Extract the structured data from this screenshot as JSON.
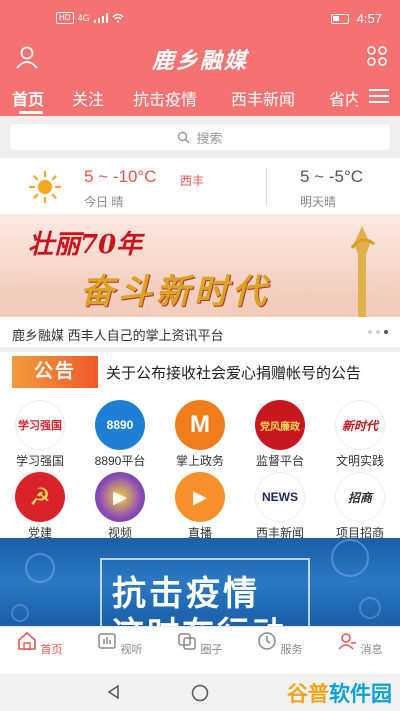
{
  "status_bar": {
    "network": "HD",
    "signal": "4G",
    "time": "4:57"
  },
  "header": {
    "title": "鹿乡融媒",
    "user_icon": "user-icon",
    "grid_icon": "apps-grid-icon"
  },
  "tabs": [
    {
      "label": "首页",
      "active": true
    },
    {
      "label": "关注"
    },
    {
      "label": "抗击疫情"
    },
    {
      "label": "西丰新闻"
    },
    {
      "label": "省内"
    }
  ],
  "search": {
    "placeholder": "搜索"
  },
  "weather": {
    "today_temp": "5 ~ -10°C",
    "location": "西丰",
    "today_label": "今日 晴",
    "tomorrow_temp": "5 ~ -5°C",
    "tomorrow_label": "明天晴"
  },
  "banner": {
    "line1": "壮丽70年",
    "line2": "奋斗新时代"
  },
  "caption": {
    "text": "鹿乡融媒   西丰人自己的掌上资讯平台",
    "dots": 3,
    "active_dot": 2
  },
  "notice": {
    "badge": "公告",
    "text": "关于公布接收社会爱心捐赠帐号的公告"
  },
  "grid": [
    {
      "label": "学习强国",
      "icon_text": "学习强国",
      "color": "#d9232b"
    },
    {
      "label": "8890平台",
      "icon_text": "8890",
      "color": "#1e7fd6"
    },
    {
      "label": "掌上政务",
      "icon_text": "M",
      "color": "#f07d1b"
    },
    {
      "label": "监督平台",
      "icon_text": "党风廉政",
      "color": "#c8171e"
    },
    {
      "label": "文明实践",
      "icon_text": "新时代",
      "color": "#ffffff"
    },
    {
      "label": "党建",
      "icon_text": "☭",
      "color": "#d9232b"
    },
    {
      "label": "视频",
      "icon_text": "▶",
      "color": "#6a4aa8"
    },
    {
      "label": "直播",
      "icon_text": "▶",
      "color": "#f5902a"
    },
    {
      "label": "西丰新闻",
      "icon_text": "NEWS",
      "color": "#ffffff"
    },
    {
      "label": "项目招商",
      "icon_text": "招商",
      "color": "#ffffff"
    }
  ],
  "promo": {
    "line1": "抗击疫情",
    "line2": "这时在行动"
  },
  "bottom_nav": [
    {
      "label": "首页",
      "icon": "home-icon",
      "active": true
    },
    {
      "label": "视听",
      "icon": "video-icon"
    },
    {
      "label": "圈子",
      "icon": "circle-icon"
    },
    {
      "label": "服务",
      "icon": "service-icon"
    },
    {
      "label": "消息",
      "icon": "message-icon"
    }
  ],
  "watermark": {
    "part1": "谷普",
    "part2": "软件园"
  },
  "colors": {
    "brand": "#f47271",
    "accent": "#e8554e"
  }
}
